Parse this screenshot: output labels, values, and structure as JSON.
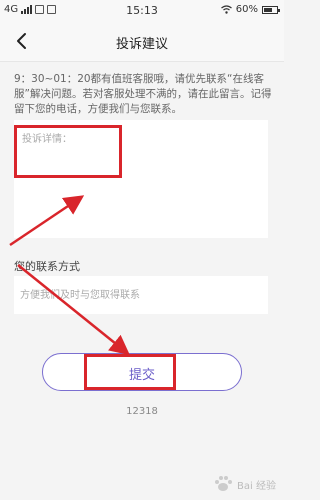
{
  "status_bar": {
    "network": "4G",
    "time": "15:13",
    "battery": "60%"
  },
  "nav": {
    "title": "投诉建议"
  },
  "notice": {
    "text": "9：30~01：20都有值班客服哦，请优先联系“在线客服”解决问题。若对客服处理不满的，请在此留言。记得留下您的电话，方便我们与您联系。"
  },
  "complaint": {
    "placeholder": "投诉详情："
  },
  "contact": {
    "label": "您的联系方式",
    "placeholder": "方便我们及时与您取得联系"
  },
  "submit": {
    "label": "提交"
  },
  "footer": {
    "number": "12318"
  },
  "watermark": {
    "text": "Bai 经验"
  },
  "colors": {
    "accent": "#6a5cc8",
    "annotation_red": "#d9252b"
  }
}
